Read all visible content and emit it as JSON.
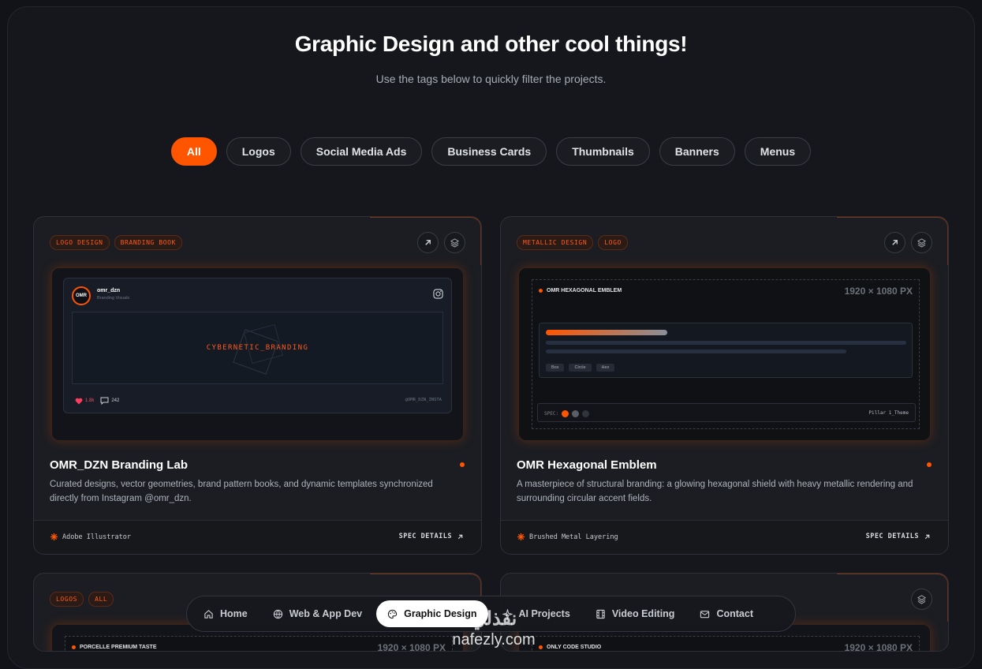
{
  "header": {
    "title": "Graphic Design and other cool things!",
    "subtitle": "Use the tags below to quickly filter the projects."
  },
  "filters": [
    {
      "label": "All",
      "active": true
    },
    {
      "label": "Logos"
    },
    {
      "label": "Social Media Ads"
    },
    {
      "label": "Business Cards"
    },
    {
      "label": "Thumbnails"
    },
    {
      "label": "Banners"
    },
    {
      "label": "Menus"
    }
  ],
  "cards": [
    {
      "tags": [
        "LOGO DESIGN",
        "BRANDING BOOK"
      ],
      "title": "OMR_DZN Branding Lab",
      "description": "Curated designs, vector geometries, brand pattern books, and dynamic templates synchronized directly from Instagram @omr_dzn.",
      "tool": "Adobe Illustrator",
      "spec_label": "SPEC DETAILS",
      "preview": {
        "avatar": "OMR",
        "username": "omr_dzn",
        "user_sub": "Branding Visuals",
        "canvas_text": "CYBERNETIC_BRANDING",
        "likes": "1.8k",
        "comments": "242",
        "handle": "@OMR_DZN_INSTA"
      }
    },
    {
      "tags": [
        "METALLIC DESIGN",
        "LOGO"
      ],
      "title": "OMR Hexagonal Emblem",
      "description": "A masterpiece of structural branding: a glowing hexagonal shield with heavy metallic rendering and surrounding circular accent fields.",
      "tool": "Brushed Metal Layering",
      "spec_label": "SPEC DETAILS",
      "preview": {
        "label": "OMR HEXAGONAL EMBLEM",
        "dimensions": "1920 × 1080 PX",
        "chips": [
          "Box",
          "Circle",
          "Hex"
        ],
        "spec": "SPEC:",
        "theme": "Pillar 1_Theme"
      }
    },
    {
      "tags": [
        "LOGOS",
        "ALL"
      ],
      "preview": {
        "label": "PORCELLE PREMIUM TASTE",
        "dimensions": "1920 × 1080 PX"
      }
    },
    {
      "preview": {
        "label": "ONLY CODE STUDIO",
        "dimensions": "1920 × 1080 PX"
      }
    }
  ],
  "nav": [
    {
      "label": "Home",
      "icon": "home-icon"
    },
    {
      "label": "Web & App Dev",
      "icon": "globe-icon"
    },
    {
      "label": "Graphic Design",
      "icon": "palette-icon",
      "active": true
    },
    {
      "label": "AI Projects",
      "icon": "sparkle-icon"
    },
    {
      "label": "Video Editing",
      "icon": "film-icon"
    },
    {
      "label": "Contact",
      "icon": "mail-icon"
    }
  ],
  "watermark": {
    "arabic": "نفذلي",
    "latin": "nafezly.com"
  },
  "colors": {
    "accent": "#ff5500",
    "background": "#15171c"
  }
}
